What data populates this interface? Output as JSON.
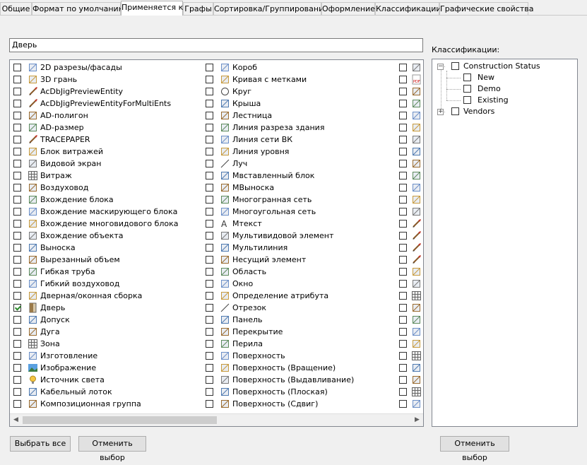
{
  "tabs": [
    "Общие",
    "Формат по умолчанию",
    "Применяется к",
    "Графы",
    "Сортировка/Группирование",
    "Оформление",
    "Классификации",
    "Графические свойства"
  ],
  "active_tab": "Применяется к",
  "name_field": {
    "value": "Дверь"
  },
  "object_columns": [
    [
      {
        "label": "2D разрезы/фасады",
        "icon": "2d-section-icon",
        "checked": false
      },
      {
        "label": "3D грань",
        "icon": "3d-face-icon",
        "checked": false
      },
      {
        "label": "AcDbJigPreviewEntity",
        "icon": "brush-icon",
        "checked": false
      },
      {
        "label": "AcDbJigPreviewEntityForMultiEnts",
        "icon": "brush-icon",
        "checked": false
      },
      {
        "label": "AD-полигон",
        "icon": "polygon-icon",
        "checked": false
      },
      {
        "label": "AD-размер",
        "icon": "dimension-icon",
        "checked": false
      },
      {
        "label": "TRACEPAPER",
        "icon": "brush-icon",
        "checked": false
      },
      {
        "label": "Блок витражей",
        "icon": "curtain-wall-unit-icon",
        "checked": false
      },
      {
        "label": "Видовой экран",
        "icon": "viewport-icon",
        "checked": false
      },
      {
        "label": "Витраж",
        "icon": "curtain-wall-icon",
        "checked": false
      },
      {
        "label": "Воздуховод",
        "icon": "duct-icon",
        "checked": false
      },
      {
        "label": "Вхождение блока",
        "icon": "block-reference-icon",
        "checked": false
      },
      {
        "label": "Вхождение маскирующего блока",
        "icon": "mask-block-icon",
        "checked": false
      },
      {
        "label": "Вхождение многовидового блока",
        "icon": "multiview-block-icon",
        "checked": false
      },
      {
        "label": "Вхождение объекта",
        "icon": "object-reference-icon",
        "checked": false
      },
      {
        "label": "Выноска",
        "icon": "leader-icon",
        "checked": false
      },
      {
        "label": "Вырезанный объем",
        "icon": "cut-volume-icon",
        "checked": false
      },
      {
        "label": "Гибкая труба",
        "icon": "flex-pipe-icon",
        "checked": false
      },
      {
        "label": "Гибкий воздуховод",
        "icon": "flex-duct-icon",
        "checked": false
      },
      {
        "label": "Дверная/оконная сборка",
        "icon": "door-window-assembly-icon",
        "checked": false
      },
      {
        "label": "Дверь",
        "icon": "door-icon",
        "checked": true
      },
      {
        "label": "Допуск",
        "icon": "tolerance-icon",
        "checked": false
      },
      {
        "label": "Дуга",
        "icon": "arc-icon",
        "checked": false
      },
      {
        "label": "Зона",
        "icon": "zone-icon",
        "checked": false
      },
      {
        "label": "Изготовление",
        "icon": "fabrication-icon",
        "checked": false
      },
      {
        "label": "Изображение",
        "icon": "image-icon",
        "checked": false
      },
      {
        "label": "Источник света",
        "icon": "light-icon",
        "checked": false
      },
      {
        "label": "Кабельный лоток",
        "icon": "cable-tray-icon",
        "checked": false
      },
      {
        "label": "Композиционная группа",
        "icon": "group-icon",
        "checked": false
      }
    ],
    [
      {
        "label": "Короб",
        "icon": "raceway-icon",
        "checked": false
      },
      {
        "label": "Кривая с метками",
        "icon": "labeled-curve-icon",
        "checked": false
      },
      {
        "label": "Круг",
        "icon": "circle-icon",
        "checked": false
      },
      {
        "label": "Крыша",
        "icon": "roof-icon",
        "checked": false
      },
      {
        "label": "Лестница",
        "icon": "stair-icon",
        "checked": false
      },
      {
        "label": "Линия разреза здания",
        "icon": "section-line-icon",
        "checked": false
      },
      {
        "label": "Линия сети ВК",
        "icon": "pipe-line-icon",
        "checked": false
      },
      {
        "label": "Линия уровня",
        "icon": "level-line-icon",
        "checked": false
      },
      {
        "label": "Луч",
        "icon": "ray-icon",
        "checked": false
      },
      {
        "label": "Мвставленный блок",
        "icon": "minsert-icon",
        "checked": false
      },
      {
        "label": "МВыноска",
        "icon": "mleader-icon",
        "checked": false
      },
      {
        "label": "Многогранная сеть",
        "icon": "polyface-mesh-icon",
        "checked": false
      },
      {
        "label": "Многоугольная сеть",
        "icon": "polygon-mesh-icon",
        "checked": false
      },
      {
        "label": "Мтекст",
        "icon": "mtext-icon",
        "checked": false
      },
      {
        "label": "Мультивидовой элемент",
        "icon": "multiview-element-icon",
        "checked": false
      },
      {
        "label": "Мультилиния",
        "icon": "mline-icon",
        "checked": false
      },
      {
        "label": "Несущий элемент",
        "icon": "structural-member-icon",
        "checked": false
      },
      {
        "label": "Область",
        "icon": "region-icon",
        "checked": false
      },
      {
        "label": "Окно",
        "icon": "window-icon",
        "checked": false
      },
      {
        "label": "Определение атрибута",
        "icon": "attribute-definition-icon",
        "checked": false
      },
      {
        "label": "Отрезок",
        "icon": "line-icon",
        "checked": false
      },
      {
        "label": "Панель",
        "icon": "panel-icon",
        "checked": false
      },
      {
        "label": "Перекрытие",
        "icon": "slab-icon",
        "checked": false
      },
      {
        "label": "Перила",
        "icon": "railing-icon",
        "checked": false
      },
      {
        "label": "Поверхность",
        "icon": "surface-icon",
        "checked": false
      },
      {
        "label": "Поверхность (Вращение)",
        "icon": "revolved-surface-icon",
        "checked": false
      },
      {
        "label": "Поверхность (Выдавливание)",
        "icon": "extruded-surface-icon",
        "checked": false
      },
      {
        "label": "Поверхность (Плоская)",
        "icon": "planar-surface-icon",
        "checked": false
      },
      {
        "label": "Поверхность (Сдвиг)",
        "icon": "swept-surface-icon",
        "checked": false
      }
    ]
  ],
  "third_column_icons": [
    "vase-icon",
    "pdf-icon",
    "dashed-arc-icon",
    "dashed-bracket-icon",
    "angle-icon",
    "shape-icon",
    "shape-icon",
    "shape-icon",
    "hook-icon",
    "frame-icon",
    "window-icon",
    "dots-icon",
    "pencil-icon",
    "brush-icon",
    "brush-icon",
    "brush-icon",
    "brush-icon",
    "spiral-icon",
    "dotted-curve-icon",
    "grid-icon",
    "cube-icon",
    "shape-icon",
    "house-icon",
    "dots-grid-icon",
    "grid-icon",
    "cube-icon",
    "frame-icon",
    "grid-icon",
    "coil-icon"
  ],
  "classifications": {
    "label": "Классификации:",
    "tree": [
      {
        "label": "Construction Status",
        "children": [
          "New",
          "Demo",
          "Existing"
        ],
        "expanded": true
      },
      {
        "label": "Vendors",
        "children": [],
        "expanded": false
      }
    ]
  },
  "buttons": {
    "select_all": "Выбрать все",
    "deselect": "Отменить выбор",
    "deselect_right": "Отменить выбор"
  }
}
